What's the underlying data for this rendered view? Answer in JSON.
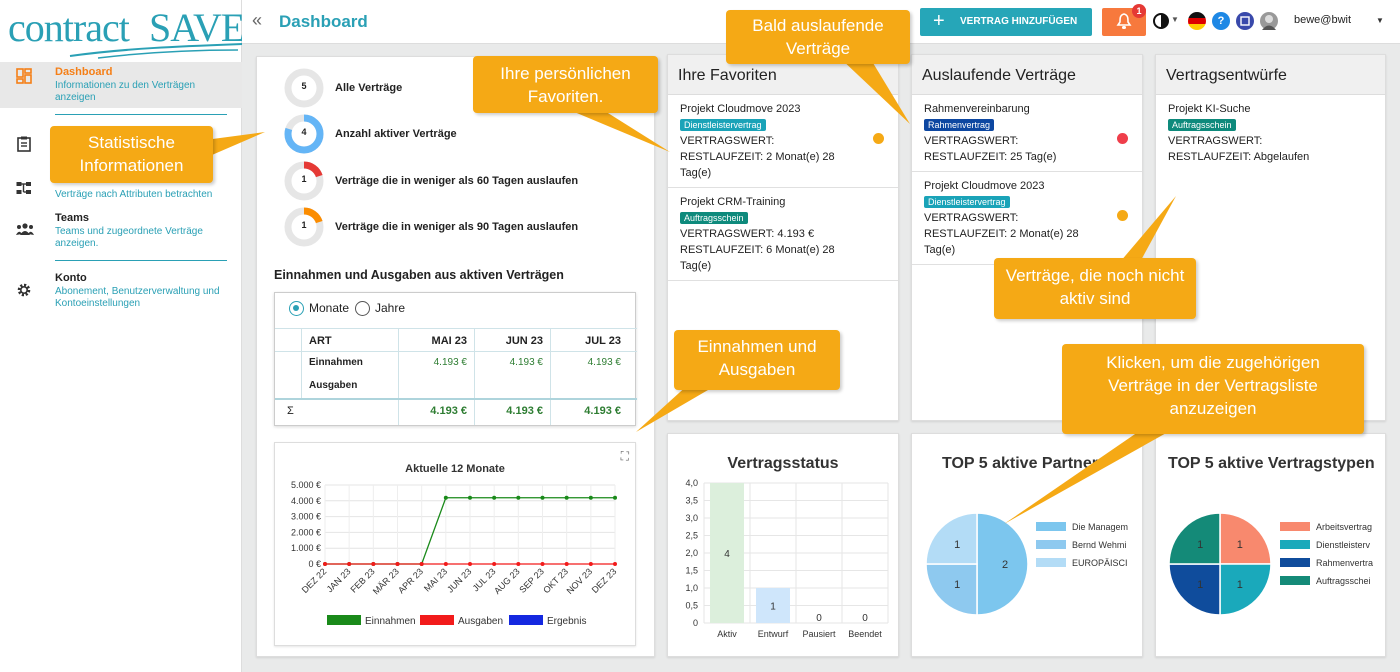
{
  "logo": {
    "part1": "contract",
    "part2": "SAVE"
  },
  "sidebar": {
    "items": [
      {
        "title": "Dashboard",
        "desc": "Informationen zu den Verträgen anzeigen",
        "icon": "dashboard-icon"
      },
      {
        "title": "",
        "desc": "",
        "icon": "clipboard-icon"
      },
      {
        "title": "",
        "desc": "Verträge nach Attributen betrachten",
        "icon": "sitemap-icon"
      },
      {
        "title": "Teams",
        "desc": "Teams und zugeordnete Verträge anzeigen.",
        "icon": "team-icon"
      },
      {
        "title": "Konto",
        "desc": "Abonement, Benutzerverwaltung und Kontoeinstellungen",
        "icon": "gear-icon"
      }
    ]
  },
  "header": {
    "collapse": "«",
    "title": "Dashboard",
    "add_button": "VERTRAG HINZUFÜGEN",
    "bell_count": "1",
    "user": "bewe@bwit"
  },
  "stats": [
    {
      "value": "5",
      "label": "Alle Verträge",
      "color": "#cccccc",
      "fraction": 0
    },
    {
      "value": "4",
      "label": "Anzahl aktiver Verträge",
      "color": "#64b5f6",
      "fraction": 0.8
    },
    {
      "value": "1",
      "label": "Verträge die in weniger als 60 Tagen auslaufen",
      "color": "#e53935",
      "fraction": 0.2
    },
    {
      "value": "1",
      "label": "Verträge die in weniger als 90 Tagen auslaufen",
      "color": "#fb8c00",
      "fraction": 0.2
    }
  ],
  "finance": {
    "title": "Einnahmen und Ausgaben aus aktiven Verträgen",
    "radio_months": "Monate",
    "radio_years": "Jahre",
    "headers": [
      "ART",
      "MAI 23",
      "JUN 23",
      "JUL 23"
    ],
    "rows": [
      [
        "Einnahmen",
        "4.193 €",
        "4.193 €",
        "4.193 €"
      ],
      [
        "Ausgaben",
        "",
        "",
        ""
      ]
    ],
    "sum_symbol": "Σ",
    "sums": [
      "4.193 €",
      "4.193 €",
      "4.193 €"
    ]
  },
  "favorites": {
    "title": "Ihre Favoriten",
    "items": [
      {
        "name": "Projekt Cloudmove 2023",
        "badge": "Dienstleistervertrag",
        "badge_color": "#1aa3b8",
        "value": "VERTRAGSWERT:",
        "remain": "RESTLAUFZEIT: 2 Monat(e) 28 Tag(e)",
        "dot": "#f5a915"
      },
      {
        "name": "Projekt CRM-Training",
        "badge": "Auftragsschein",
        "badge_color": "#0e8a7c",
        "value": "VERTRAGSWERT: 4.193 €",
        "remain": "RESTLAUFZEIT: 6 Monat(e) 28 Tag(e)",
        "dot": ""
      }
    ]
  },
  "expiring": {
    "title": "Auslaufende Verträge",
    "items": [
      {
        "name": "Rahmenvereinbarung",
        "badge": "Rahmenvertrag",
        "badge_color": "#0d47a1",
        "value": "VERTRAGSWERT:",
        "remain": "RESTLAUFZEIT: 25 Tag(e)",
        "dot": "#ef3e4a"
      },
      {
        "name": "Projekt Cloudmove 2023",
        "badge": "Dienstleistervertrag",
        "badge_color": "#1aa3b8",
        "value": "VERTRAGSWERT:",
        "remain": "RESTLAUFZEIT: 2 Monat(e) 28 Tag(e)",
        "dot": "#f5a915"
      }
    ]
  },
  "drafts": {
    "title": "Vertragsentwürfe",
    "items": [
      {
        "name": "Projekt KI-Suche",
        "badge": "Auftragsschein",
        "badge_color": "#0e8a7c",
        "value": "VERTRAGSWERT:",
        "remain": "RESTLAUFZEIT: Abgelaufen",
        "dot": ""
      }
    ]
  },
  "callouts": {
    "stat": "Statistische Informationen",
    "fav": "Ihre persönlichen Favoriten.",
    "exp": "Bald auslaufende Verträge",
    "draft": "Verträge, die noch nicht aktiv sind",
    "fin": "Einnahmen und Ausgaben",
    "click": "Klicken, um die zugehörigen Verträge in der Vertragsliste anzuzeigen"
  },
  "chart_data": [
    {
      "type": "line",
      "title": "Aktuelle 12 Monate",
      "categories": [
        "DEZ 22",
        "JAN 23",
        "FEB 23",
        "MÄR 23",
        "APR 23",
        "MAI 23",
        "JUN 23",
        "JUL 23",
        "AUG 23",
        "SEP 23",
        "OKT 23",
        "NOV 23",
        "DEZ 23"
      ],
      "y_ticks": [
        "5.000 €",
        "4.000 €",
        "3.000 €",
        "2.000 €",
        "1.000 €",
        "0 €"
      ],
      "ylim": [
        0,
        5000
      ],
      "series": [
        {
          "name": "Einnahmen",
          "color": "#1a8a1a",
          "values": [
            0,
            0,
            0,
            0,
            0,
            4193,
            4193,
            4193,
            4193,
            4193,
            4193,
            4193,
            4193
          ]
        },
        {
          "name": "Ausgaben",
          "color": "#f21b1b",
          "values": [
            0,
            0,
            0,
            0,
            0,
            0,
            0,
            0,
            0,
            0,
            0,
            0,
            0
          ]
        },
        {
          "name": "Ergebnis",
          "color": "#1428e0",
          "values": []
        }
      ]
    },
    {
      "type": "bar",
      "title": "Vertragsstatus",
      "categories": [
        "Aktiv",
        "Entwurf",
        "Pausiert",
        "Beendet"
      ],
      "values": [
        4,
        1,
        0,
        0
      ],
      "colors": [
        "#dcefdc",
        "#cfe6fb",
        "#eeeeee",
        "#eeeeee"
      ],
      "y_ticks": [
        "4,0",
        "3,5",
        "3,0",
        "2,5",
        "2,0",
        "1,5",
        "1,0",
        "0,5",
        "0"
      ],
      "ylim": [
        0,
        4
      ]
    },
    {
      "type": "pie",
      "title": "TOP 5 aktive Partner",
      "labels": [
        "Die Managem",
        "Bernd Wehmi",
        "EUROPÄISCI"
      ],
      "values": [
        2,
        1,
        1
      ],
      "colors": [
        "#7cc6ee",
        "#8ec9ef",
        "#b3dcf6"
      ]
    },
    {
      "type": "pie",
      "title": "TOP 5 aktive Vertragstypen",
      "labels": [
        "Arbeitsvertrag",
        "Dienstleisterv",
        "Rahmenvertra",
        "Auftragsschei"
      ],
      "values": [
        1,
        1,
        1,
        1
      ],
      "colors": [
        "#f8896e",
        "#1aa9bb",
        "#0f4c9c",
        "#148a78"
      ]
    }
  ]
}
